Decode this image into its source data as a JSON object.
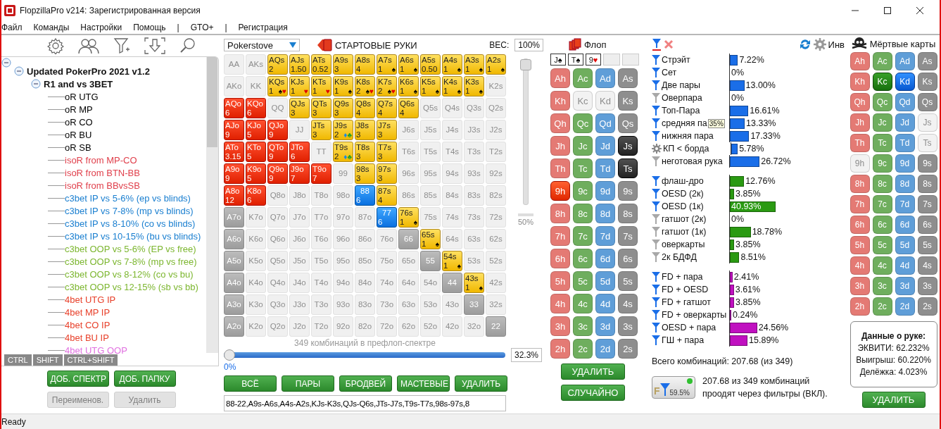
{
  "window": {
    "title": "FlopzillaPro v214: Зарегистрированная версия"
  },
  "menu": [
    "Файл",
    "Команды",
    "Настройки",
    "Помощь",
    "|",
    "GTO+",
    "|",
    "Регистрация"
  ],
  "tree": {
    "expanded": true,
    "children": [
      {
        "label": "Updated PokerPro 2021 v1.2",
        "expanded": true,
        "children": [
          {
            "label": "R1 and vs 3BET",
            "expanded": true,
            "children": [
              {
                "label": "oR UTG",
                "color": "#000000"
              },
              {
                "label": "oR MP",
                "color": "#000000"
              },
              {
                "label": "oR CO",
                "color": "#000000"
              },
              {
                "label": "oR BU",
                "color": "#000000"
              },
              {
                "label": "oR SB",
                "color": "#000000"
              },
              {
                "label": "isoR from MP-CO",
                "color": "#e0404c"
              },
              {
                "label": "isoR from BTN-BB",
                "color": "#e0404c"
              },
              {
                "label": "isoR from BBvsSB",
                "color": "#e0404c"
              },
              {
                "label": "c3bet IP vs 5-6% (ep vs blinds)",
                "color": "#1a7fd0"
              },
              {
                "label": "c3bet IP vs 7-8% (mp vs blinds)",
                "color": "#1a7fd0"
              },
              {
                "label": "c3bet IP vs 8-10% (co vs blinds)",
                "color": "#1a7fd0"
              },
              {
                "label": "c3bet IP vs 10-15% (bu vs blinds)",
                "color": "#1a7fd0"
              },
              {
                "label": "c3bet OOP vs 5-6% (EP vs free)",
                "color": "#7cb62f"
              },
              {
                "label": "c3bet OOP vs 7-8% (mp vs free)",
                "color": "#7cb62f"
              },
              {
                "label": "c3bet OOP vs 8-12% (co vs bu)",
                "color": "#7cb62f"
              },
              {
                "label": "c3bet OOP vs 12-15% (sb vs bb)",
                "color": "#7cb62f"
              },
              {
                "label": "4bet UTG IP",
                "color": "#e8402a"
              },
              {
                "label": "4bet MP IP",
                "color": "#e8402a"
              },
              {
                "label": "4bet CO IP",
                "color": "#e8402a"
              },
              {
                "label": "4bet BU IP",
                "color": "#e8402a"
              },
              {
                "label": "4bet UTG OOP",
                "color": "#e070e0"
              }
            ]
          }
        ]
      }
    ]
  },
  "modifier_tabs": [
    {
      "label": "CTRL",
      "selected": false
    },
    {
      "label": "SHIFT",
      "selected": false
    },
    {
      "label": "CTRL+SHIFT",
      "selected": false
    }
  ],
  "left_buttons": [
    {
      "label": "ДОБ. СПЕКТР",
      "disabled": false
    },
    {
      "label": "ДОБ. ПАПКУ",
      "disabled": false
    },
    {
      "label": "Переименов.",
      "disabled": true
    },
    {
      "label": "Удалить",
      "disabled": true
    }
  ],
  "range": {
    "source": "Pokerstove",
    "title": "СТАРТОВЫЕ РУКИ",
    "weight_label": "ВЕС:",
    "weight": "100%",
    "matrix": [
      [
        {
          "hand": "AA",
          "kind": "off"
        },
        {
          "hand": "AKs",
          "kind": "off"
        },
        {
          "hand": "AQs",
          "kind": "suited",
          "weight": "2"
        },
        {
          "hand": "AJs",
          "kind": "suited",
          "weight": "1.50"
        },
        {
          "hand": "ATs",
          "kind": "suited",
          "weight": "0.52"
        },
        {
          "hand": "A9s",
          "kind": "suited",
          "weight": "3"
        },
        {
          "hand": "A8s",
          "kind": "suited",
          "weight": "4"
        },
        {
          "hand": "A7s",
          "kind": "suited",
          "weight": "1",
          "suits": [
            {
              "glyph": "♠",
              "color": "#000000"
            }
          ]
        },
        {
          "hand": "A6s",
          "kind": "suited",
          "weight": "1",
          "suits": [
            {
              "glyph": "♠",
              "color": "#000000"
            }
          ]
        },
        {
          "hand": "A5s",
          "kind": "suited",
          "weight": "0.50"
        },
        {
          "hand": "A4s",
          "kind": "suited",
          "weight": "1",
          "suits": [
            {
              "glyph": "♠",
              "color": "#000000"
            }
          ]
        },
        {
          "hand": "A3s",
          "kind": "suited",
          "weight": "1",
          "suits": [
            {
              "glyph": "♠",
              "color": "#000000"
            }
          ]
        },
        {
          "hand": "A2s",
          "kind": "suited",
          "weight": "1",
          "suits": [
            {
              "glyph": "♠",
              "color": "#000000"
            }
          ]
        }
      ],
      [
        {
          "hand": "AKo",
          "kind": "off"
        },
        {
          "hand": "KK",
          "kind": "off"
        },
        {
          "hand": "KQs",
          "kind": "suited",
          "weight": "1",
          "suits": [
            {
              "glyph": "♠",
              "color": "#000000"
            },
            {
              "glyph": "♥",
              "color": "#e00000"
            }
          ]
        },
        {
          "hand": "KJs",
          "kind": "suited",
          "weight": "1",
          "suits": [
            {
              "glyph": "♥",
              "color": "#e00000"
            }
          ]
        },
        {
          "hand": "KTs",
          "kind": "suited",
          "weight": "1",
          "suits": [
            {
              "glyph": "♥",
              "color": "#e00000"
            }
          ]
        },
        {
          "hand": "K9s",
          "kind": "suited",
          "weight": "1",
          "suits": [
            {
              "glyph": "♠",
              "color": "#000000"
            }
          ]
        },
        {
          "hand": "K8s",
          "kind": "suited",
          "weight": "2",
          "suits": [
            {
              "glyph": "♠",
              "color": "#000000"
            },
            {
              "glyph": "♥",
              "color": "#e00000"
            }
          ]
        },
        {
          "hand": "K7s",
          "kind": "suited",
          "weight": "2",
          "suits": [
            {
              "glyph": "♠",
              "color": "#000000"
            },
            {
              "glyph": "♥",
              "color": "#e00000"
            }
          ]
        },
        {
          "hand": "K6s",
          "kind": "suited",
          "weight": "1",
          "suits": [
            {
              "glyph": "♠",
              "color": "#000000"
            }
          ]
        },
        {
          "hand": "K5s",
          "kind": "suited",
          "weight": "1",
          "suits": [
            {
              "glyph": "♠",
              "color": "#000000"
            }
          ]
        },
        {
          "hand": "K4s",
          "kind": "suited",
          "weight": "1",
          "suits": [
            {
              "glyph": "♠",
              "color": "#000000"
            }
          ]
        },
        {
          "hand": "K3s",
          "kind": "suited",
          "weight": "1",
          "suits": [
            {
              "glyph": "♠",
              "color": "#000000"
            }
          ]
        },
        {
          "hand": "K2s",
          "kind": "off"
        }
      ],
      [
        {
          "hand": "AQo",
          "kind": "offsuit",
          "weight": "6"
        },
        {
          "hand": "KQo",
          "kind": "offsuit",
          "weight": "6"
        },
        {
          "hand": "QQ",
          "kind": "off"
        },
        {
          "hand": "QJs",
          "kind": "suited",
          "weight": "3"
        },
        {
          "hand": "QTs",
          "kind": "suited",
          "weight": "3"
        },
        {
          "hand": "Q9s",
          "kind": "suited",
          "weight": "3"
        },
        {
          "hand": "Q8s",
          "kind": "suited",
          "weight": "4"
        },
        {
          "hand": "Q7s",
          "kind": "suited",
          "weight": "4"
        },
        {
          "hand": "Q6s",
          "kind": "suited",
          "weight": "4"
        },
        {
          "hand": "Q5s",
          "kind": "off"
        },
        {
          "hand": "Q4s",
          "kind": "off"
        },
        {
          "hand": "Q3s",
          "kind": "off"
        },
        {
          "hand": "Q2s",
          "kind": "off"
        }
      ],
      [
        {
          "hand": "AJo",
          "kind": "offsuit",
          "weight": "9"
        },
        {
          "hand": "KJo",
          "kind": "offsuit",
          "weight": "5"
        },
        {
          "hand": "QJo",
          "kind": "offsuit",
          "weight": "9"
        },
        {
          "hand": "JJ",
          "kind": "off"
        },
        {
          "hand": "JTs",
          "kind": "suited",
          "weight": "3"
        },
        {
          "hand": "J9s",
          "kind": "suited",
          "weight": "2",
          "suits": [
            {
              "glyph": "♦",
              "color": "#1a8ae8"
            },
            {
              "glyph": "♣",
              "color": "#20a020"
            }
          ]
        },
        {
          "hand": "J8s",
          "kind": "suited",
          "weight": "3"
        },
        {
          "hand": "J7s",
          "kind": "suited",
          "weight": "3"
        },
        {
          "hand": "J6s",
          "kind": "off"
        },
        {
          "hand": "J5s",
          "kind": "off"
        },
        {
          "hand": "J4s",
          "kind": "off"
        },
        {
          "hand": "J3s",
          "kind": "off"
        },
        {
          "hand": "J2s",
          "kind": "off"
        }
      ],
      [
        {
          "hand": "ATo",
          "kind": "offsuit",
          "weight": "3.15"
        },
        {
          "hand": "KTo",
          "kind": "offsuit",
          "weight": "5"
        },
        {
          "hand": "QTo",
          "kind": "offsuit",
          "weight": "9"
        },
        {
          "hand": "JTo",
          "kind": "offsuit",
          "weight": "6"
        },
        {
          "hand": "TT",
          "kind": "off"
        },
        {
          "hand": "T9s",
          "kind": "suited",
          "weight": "2",
          "suits": [
            {
              "glyph": "♦",
              "color": "#1a8ae8"
            },
            {
              "glyph": "♣",
              "color": "#20a020"
            }
          ]
        },
        {
          "hand": "T8s",
          "kind": "suited",
          "weight": "3"
        },
        {
          "hand": "T7s",
          "kind": "suited",
          "weight": "3"
        },
        {
          "hand": "T6s",
          "kind": "off"
        },
        {
          "hand": "T5s",
          "kind": "off"
        },
        {
          "hand": "T4s",
          "kind": "off"
        },
        {
          "hand": "T3s",
          "kind": "off"
        },
        {
          "hand": "T2s",
          "kind": "off"
        }
      ],
      [
        {
          "hand": "A9o",
          "kind": "offsuit",
          "weight": "9"
        },
        {
          "hand": "K9o",
          "kind": "offsuit",
          "weight": "5"
        },
        {
          "hand": "Q9o",
          "kind": "offsuit",
          "weight": "9"
        },
        {
          "hand": "J9o",
          "kind": "offsuit",
          "weight": "7"
        },
        {
          "hand": "T9o",
          "kind": "offsuit",
          "weight": "7"
        },
        {
          "hand": "99",
          "kind": "off"
        },
        {
          "hand": "98s",
          "kind": "suited",
          "weight": "3"
        },
        {
          "hand": "97s",
          "kind": "suited",
          "weight": "3"
        },
        {
          "hand": "96s",
          "kind": "off"
        },
        {
          "hand": "95s",
          "kind": "off"
        },
        {
          "hand": "94s",
          "kind": "off"
        },
        {
          "hand": "93s",
          "kind": "off"
        },
        {
          "hand": "92s",
          "kind": "off"
        }
      ],
      [
        {
          "hand": "A8o",
          "kind": "offsuit",
          "weight": "12"
        },
        {
          "hand": "K8o",
          "kind": "offsuit",
          "weight": "6"
        },
        {
          "hand": "Q8o",
          "kind": "off"
        },
        {
          "hand": "J8o",
          "kind": "off"
        },
        {
          "hand": "T8o",
          "kind": "off"
        },
        {
          "hand": "98o",
          "kind": "off"
        },
        {
          "hand": "88",
          "kind": "pair",
          "weight": "6"
        },
        {
          "hand": "87s",
          "kind": "suited",
          "weight": "4"
        },
        {
          "hand": "86s",
          "kind": "off"
        },
        {
          "hand": "85s",
          "kind": "off"
        },
        {
          "hand": "84s",
          "kind": "off"
        },
        {
          "hand": "83s",
          "kind": "off"
        },
        {
          "hand": "82s",
          "kind": "off"
        }
      ],
      [
        {
          "hand": "A7o",
          "kind": "dim"
        },
        {
          "hand": "K7o",
          "kind": "off"
        },
        {
          "hand": "Q7o",
          "kind": "off"
        },
        {
          "hand": "J7o",
          "kind": "off"
        },
        {
          "hand": "T7o",
          "kind": "off"
        },
        {
          "hand": "97o",
          "kind": "off"
        },
        {
          "hand": "87o",
          "kind": "off"
        },
        {
          "hand": "77",
          "kind": "pair",
          "weight": "6"
        },
        {
          "hand": "76s",
          "kind": "suited",
          "weight": "1",
          "suits": [
            {
              "glyph": "♠",
              "color": "#000000"
            }
          ]
        },
        {
          "hand": "75s",
          "kind": "off"
        },
        {
          "hand": "74s",
          "kind": "off"
        },
        {
          "hand": "73s",
          "kind": "off"
        },
        {
          "hand": "72s",
          "kind": "off"
        }
      ],
      [
        {
          "hand": "A6o",
          "kind": "dim"
        },
        {
          "hand": "K6o",
          "kind": "off"
        },
        {
          "hand": "Q6o",
          "kind": "off"
        },
        {
          "hand": "J6o",
          "kind": "off"
        },
        {
          "hand": "T6o",
          "kind": "off"
        },
        {
          "hand": "96o",
          "kind": "off"
        },
        {
          "hand": "86o",
          "kind": "off"
        },
        {
          "hand": "76o",
          "kind": "off"
        },
        {
          "hand": "66",
          "kind": "dim"
        },
        {
          "hand": "65s",
          "kind": "suited",
          "weight": "1",
          "suits": [
            {
              "glyph": "♠",
              "color": "#000000"
            }
          ]
        },
        {
          "hand": "64s",
          "kind": "off"
        },
        {
          "hand": "63s",
          "kind": "off"
        },
        {
          "hand": "62s",
          "kind": "off"
        }
      ],
      [
        {
          "hand": "A5o",
          "kind": "dim"
        },
        {
          "hand": "K5o",
          "kind": "off"
        },
        {
          "hand": "Q5o",
          "kind": "off"
        },
        {
          "hand": "J5o",
          "kind": "off"
        },
        {
          "hand": "T5o",
          "kind": "off"
        },
        {
          "hand": "95o",
          "kind": "off"
        },
        {
          "hand": "85o",
          "kind": "off"
        },
        {
          "hand": "75o",
          "kind": "off"
        },
        {
          "hand": "65o",
          "kind": "off"
        },
        {
          "hand": "55",
          "kind": "dim"
        },
        {
          "hand": "54s",
          "kind": "suited",
          "weight": "1",
          "suits": [
            {
              "glyph": "♠",
              "color": "#000000"
            }
          ]
        },
        {
          "hand": "53s",
          "kind": "off"
        },
        {
          "hand": "52s",
          "kind": "off"
        }
      ],
      [
        {
          "hand": "A4o",
          "kind": "dim"
        },
        {
          "hand": "K4o",
          "kind": "off"
        },
        {
          "hand": "Q4o",
          "kind": "off"
        },
        {
          "hand": "J4o",
          "kind": "off"
        },
        {
          "hand": "T4o",
          "kind": "off"
        },
        {
          "hand": "94o",
          "kind": "off"
        },
        {
          "hand": "84o",
          "kind": "off"
        },
        {
          "hand": "74o",
          "kind": "off"
        },
        {
          "hand": "64o",
          "kind": "off"
        },
        {
          "hand": "54o",
          "kind": "off"
        },
        {
          "hand": "44",
          "kind": "dim"
        },
        {
          "hand": "43s",
          "kind": "suited",
          "weight": "1",
          "suits": [
            {
              "glyph": "♠",
              "color": "#000000"
            }
          ]
        },
        {
          "hand": "42s",
          "kind": "off"
        }
      ],
      [
        {
          "hand": "A3o",
          "kind": "dim"
        },
        {
          "hand": "K3o",
          "kind": "off"
        },
        {
          "hand": "Q3o",
          "kind": "off"
        },
        {
          "hand": "J3o",
          "kind": "off"
        },
        {
          "hand": "T3o",
          "kind": "off"
        },
        {
          "hand": "93o",
          "kind": "off"
        },
        {
          "hand": "83o",
          "kind": "off"
        },
        {
          "hand": "73o",
          "kind": "off"
        },
        {
          "hand": "63o",
          "kind": "off"
        },
        {
          "hand": "53o",
          "kind": "off"
        },
        {
          "hand": "43o",
          "kind": "off"
        },
        {
          "hand": "33",
          "kind": "dim"
        },
        {
          "hand": "32s",
          "kind": "off"
        }
      ],
      [
        {
          "hand": "A2o",
          "kind": "dim"
        },
        {
          "hand": "K2o",
          "kind": "off"
        },
        {
          "hand": "Q2o",
          "kind": "off"
        },
        {
          "hand": "J2o",
          "kind": "off"
        },
        {
          "hand": "T2o",
          "kind": "off"
        },
        {
          "hand": "92o",
          "kind": "off"
        },
        {
          "hand": "82o",
          "kind": "off"
        },
        {
          "hand": "72o",
          "kind": "off"
        },
        {
          "hand": "62o",
          "kind": "off"
        },
        {
          "hand": "52o",
          "kind": "off"
        },
        {
          "hand": "42o",
          "kind": "off"
        },
        {
          "hand": "32o",
          "kind": "off"
        },
        {
          "hand": "22",
          "kind": "dim"
        }
      ]
    ],
    "weight_slider": {
      "level": 1,
      "label": "50%"
    },
    "combo_caption": "349 комбинаций в префлоп-спектре",
    "percent_slider": {
      "level": 0,
      "min_label": "0%",
      "value": "32.3%"
    },
    "buttons": [
      "ВСЁ",
      "ПАРЫ",
      "БРОДВЕЙ",
      "МАСТЕВЫЕ",
      "УДАЛИТЬ"
    ],
    "range_text": "88-22,A9s-A6s,A4s-A2s,KJs-K3s,QJs-Q6s,JTs-J7s,T9s-T7s,98s-97s,8"
  },
  "flop": {
    "title": "Флоп",
    "board": [
      {
        "kind": "card",
        "rank": "J",
        "suit": "♠",
        "color": "#000000"
      },
      {
        "kind": "card",
        "rank": "T",
        "suit": "♠",
        "color": "#000000"
      },
      {
        "kind": "card",
        "rank": "9",
        "suit": "♥",
        "color": "#e00000"
      },
      {
        "kind": "empty"
      },
      {
        "kind": "empty"
      }
    ],
    "cards": [
      {
        "label": "Ah",
        "kind": "hearts",
        "selected": false,
        "disabled": false
      },
      {
        "label": "Ac",
        "kind": "clubs",
        "selected": false,
        "disabled": false
      },
      {
        "label": "Ad",
        "kind": "diamonds",
        "selected": false,
        "disabled": false
      },
      {
        "label": "As",
        "kind": "spades",
        "selected": false,
        "disabled": false
      },
      {
        "label": "Kh",
        "kind": "hearts",
        "selected": false,
        "disabled": false
      },
      {
        "label": "Kc",
        "kind": "clubs",
        "selected": false,
        "disabled": true
      },
      {
        "label": "Kd",
        "kind": "diamonds",
        "selected": false,
        "disabled": true
      },
      {
        "label": "Ks",
        "kind": "spades",
        "selected": false,
        "disabled": false
      },
      {
        "label": "Qh",
        "kind": "hearts",
        "selected": false,
        "disabled": false
      },
      {
        "label": "Qc",
        "kind": "clubs",
        "selected": false,
        "disabled": false
      },
      {
        "label": "Qd",
        "kind": "diamonds",
        "selected": false,
        "disabled": false
      },
      {
        "label": "Qs",
        "kind": "spades",
        "selected": false,
        "disabled": false
      },
      {
        "label": "Jh",
        "kind": "hearts",
        "selected": false,
        "disabled": false
      },
      {
        "label": "Jc",
        "kind": "clubs",
        "selected": false,
        "disabled": false
      },
      {
        "label": "Jd",
        "kind": "diamonds",
        "selected": false,
        "disabled": false
      },
      {
        "label": "Js",
        "kind": "spades",
        "selected": true,
        "disabled": false
      },
      {
        "label": "Th",
        "kind": "hearts",
        "selected": false,
        "disabled": false
      },
      {
        "label": "Tc",
        "kind": "clubs",
        "selected": false,
        "disabled": false
      },
      {
        "label": "Td",
        "kind": "diamonds",
        "selected": false,
        "disabled": false
      },
      {
        "label": "Ts",
        "kind": "spades",
        "selected": true,
        "disabled": false
      },
      {
        "label": "9h",
        "kind": "hearts",
        "selected": true,
        "disabled": false
      },
      {
        "label": "9c",
        "kind": "clubs",
        "selected": false,
        "disabled": false
      },
      {
        "label": "9d",
        "kind": "diamonds",
        "selected": false,
        "disabled": false
      },
      {
        "label": "9s",
        "kind": "spades",
        "selected": false,
        "disabled": false
      },
      {
        "label": "8h",
        "kind": "hearts",
        "selected": false,
        "disabled": false
      },
      {
        "label": "8c",
        "kind": "clubs",
        "selected": false,
        "disabled": false
      },
      {
        "label": "8d",
        "kind": "diamonds",
        "selected": false,
        "disabled": false
      },
      {
        "label": "8s",
        "kind": "spades",
        "selected": false,
        "disabled": false
      },
      {
        "label": "7h",
        "kind": "hearts",
        "selected": false,
        "disabled": false
      },
      {
        "label": "7c",
        "kind": "clubs",
        "selected": false,
        "disabled": false
      },
      {
        "label": "7d",
        "kind": "diamonds",
        "selected": false,
        "disabled": false
      },
      {
        "label": "7s",
        "kind": "spades",
        "selected": false,
        "disabled": false
      },
      {
        "label": "6h",
        "kind": "hearts",
        "selected": false,
        "disabled": false
      },
      {
        "label": "6c",
        "kind": "clubs",
        "selected": false,
        "disabled": false
      },
      {
        "label": "6d",
        "kind": "diamonds",
        "selected": false,
        "disabled": false
      },
      {
        "label": "6s",
        "kind": "spades",
        "selected": false,
        "disabled": false
      },
      {
        "label": "5h",
        "kind": "hearts",
        "selected": false,
        "disabled": false
      },
      {
        "label": "5c",
        "kind": "clubs",
        "selected": false,
        "disabled": false
      },
      {
        "label": "5d",
        "kind": "diamonds",
        "selected": false,
        "disabled": false
      },
      {
        "label": "5s",
        "kind": "spades",
        "selected": false,
        "disabled": false
      },
      {
        "label": "4h",
        "kind": "hearts",
        "selected": false,
        "disabled": false
      },
      {
        "label": "4c",
        "kind": "clubs",
        "selected": false,
        "disabled": false
      },
      {
        "label": "4d",
        "kind": "diamonds",
        "selected": false,
        "disabled": false
      },
      {
        "label": "4s",
        "kind": "spades",
        "selected": false,
        "disabled": false
      },
      {
        "label": "3h",
        "kind": "hearts",
        "selected": false,
        "disabled": false
      },
      {
        "label": "3c",
        "kind": "clubs",
        "selected": false,
        "disabled": false
      },
      {
        "label": "3d",
        "kind": "diamonds",
        "selected": false,
        "disabled": false
      },
      {
        "label": "3s",
        "kind": "spades",
        "selected": false,
        "disabled": false
      },
      {
        "label": "2h",
        "kind": "hearts",
        "selected": false,
        "disabled": false
      },
      {
        "label": "2c",
        "kind": "clubs",
        "selected": false,
        "disabled": false
      },
      {
        "label": "2d",
        "kind": "diamonds",
        "selected": false,
        "disabled": false
      },
      {
        "label": "2s",
        "kind": "spades",
        "selected": false,
        "disabled": false
      }
    ],
    "buttons": [
      "УДАЛИТЬ",
      "СЛУЧАЙНО"
    ]
  },
  "stats": {
    "toggle_label": "Инв",
    "groups": [
      {
        "color": "#1a6ee8",
        "rows": [
          {
            "kind": "filter",
            "active": true,
            "label": "Стрэйт",
            "value": "7.22%",
            "level": 0.0722
          },
          {
            "kind": "filter",
            "active": true,
            "label": "Сет",
            "value": "0%",
            "level": 0
          },
          {
            "kind": "filter",
            "active": true,
            "label": "Две пары",
            "value": "13.00%",
            "level": 0.13
          },
          {
            "kind": "filter",
            "active": false,
            "label": "Оверпара",
            "value": "0%",
            "level": 0
          },
          {
            "kind": "filter",
            "active": true,
            "label": "Топ-Пара",
            "value": "16.61%",
            "level": 0.1661
          },
          {
            "kind": "filter",
            "active": true,
            "label": "средняя па",
            "value": "13.33%",
            "level": 0.1333,
            "tooltip": "35%"
          },
          {
            "kind": "filter",
            "active": true,
            "label": "нижняя пара",
            "value": "17.33%",
            "level": 0.1733
          },
          {
            "kind": "gear",
            "label": "КП < борда",
            "value": "5.78%",
            "level": 0.0578
          },
          {
            "kind": "filter",
            "active": false,
            "label": "неготовая рука",
            "value": "26.72%",
            "level": 0.2672
          }
        ]
      },
      {
        "color": "#2a9a12",
        "rows": [
          {
            "kind": "filter",
            "active": true,
            "label": "флаш-дро",
            "value": "12.76%",
            "level": 0.1276
          },
          {
            "kind": "filter",
            "active": true,
            "label": "OESD (2к)",
            "value": "3.85%",
            "level": 0.0385
          },
          {
            "kind": "filter",
            "active": true,
            "label": "OESD (1к)",
            "value": "40.93%",
            "level": 0.4093
          },
          {
            "kind": "filter",
            "active": false,
            "label": "гатшот (2к)",
            "value": "0%",
            "level": 0
          },
          {
            "kind": "filter",
            "active": false,
            "label": "гатшот (1к)",
            "value": "18.78%",
            "level": 0.1878
          },
          {
            "kind": "filter",
            "active": false,
            "label": "оверкарты",
            "value": "3.85%",
            "level": 0.0385
          },
          {
            "kind": "filter",
            "active": false,
            "label": "2к БДФД",
            "value": "8.51%",
            "level": 0.0851
          }
        ]
      },
      {
        "color": "#c010c0",
        "rows": [
          {
            "kind": "filter",
            "active": true,
            "label": "FD + пара",
            "value": "2.41%",
            "level": 0.0241
          },
          {
            "kind": "filter",
            "active": true,
            "label": "FD + OESD",
            "value": "3.61%",
            "level": 0.0361
          },
          {
            "kind": "filter",
            "active": true,
            "label": "FD + гатшот",
            "value": "3.85%",
            "level": 0.0385
          },
          {
            "kind": "filter",
            "active": true,
            "label": "FD + оверкарты",
            "value": "0.24%",
            "level": 0.0024
          },
          {
            "kind": "filter",
            "active": true,
            "label": "OESD + пара",
            "value": "24.56%",
            "level": 0.2456
          },
          {
            "kind": "filter",
            "active": true,
            "label": "ГШ + пара",
            "value": "15.89%",
            "level": 0.1589
          }
        ]
      }
    ],
    "total": "Всего комбинаций: 207.68 (из 349)",
    "filter_button": {
      "letter": "F",
      "value": "59.5%",
      "on": true
    },
    "filter_note": "207.68 из 349 комбинаций проодят через фильтры (ВКЛ)."
  },
  "dead": {
    "title": "Мёртвые карты",
    "cards": [
      {
        "label": "Ah",
        "kind": "hearts",
        "selected": false,
        "disabled": false
      },
      {
        "label": "Ac",
        "kind": "clubs",
        "selected": false,
        "disabled": false
      },
      {
        "label": "Ad",
        "kind": "diamonds",
        "selected": false,
        "disabled": false
      },
      {
        "label": "As",
        "kind": "spades",
        "selected": false,
        "disabled": false
      },
      {
        "label": "Kh",
        "kind": "hearts",
        "selected": false,
        "disabled": false
      },
      {
        "label": "Kc",
        "kind": "clubs",
        "selected": true,
        "disabled": false
      },
      {
        "label": "Kd",
        "kind": "diamonds",
        "selected": true,
        "disabled": false
      },
      {
        "label": "Ks",
        "kind": "spades",
        "selected": false,
        "disabled": false
      },
      {
        "label": "Qh",
        "kind": "hearts",
        "selected": false,
        "disabled": false
      },
      {
        "label": "Qc",
        "kind": "clubs",
        "selected": false,
        "disabled": false
      },
      {
        "label": "Qd",
        "kind": "diamonds",
        "selected": false,
        "disabled": false
      },
      {
        "label": "Qs",
        "kind": "spades",
        "selected": false,
        "disabled": false
      },
      {
        "label": "Jh",
        "kind": "hearts",
        "selected": false,
        "disabled": false
      },
      {
        "label": "Jc",
        "kind": "clubs",
        "selected": false,
        "disabled": false
      },
      {
        "label": "Jd",
        "kind": "diamonds",
        "selected": false,
        "disabled": false
      },
      {
        "label": "Js",
        "kind": "spades",
        "selected": false,
        "disabled": true
      },
      {
        "label": "Th",
        "kind": "hearts",
        "selected": false,
        "disabled": false
      },
      {
        "label": "Tc",
        "kind": "clubs",
        "selected": false,
        "disabled": false
      },
      {
        "label": "Td",
        "kind": "diamonds",
        "selected": false,
        "disabled": false
      },
      {
        "label": "Ts",
        "kind": "spades",
        "selected": false,
        "disabled": true
      },
      {
        "label": "9h",
        "kind": "hearts",
        "selected": false,
        "disabled": true
      },
      {
        "label": "9c",
        "kind": "clubs",
        "selected": false,
        "disabled": false
      },
      {
        "label": "9d",
        "kind": "diamonds",
        "selected": false,
        "disabled": false
      },
      {
        "label": "9s",
        "kind": "spades",
        "selected": false,
        "disabled": false
      },
      {
        "label": "8h",
        "kind": "hearts",
        "selected": false,
        "disabled": false
      },
      {
        "label": "8c",
        "kind": "clubs",
        "selected": false,
        "disabled": false
      },
      {
        "label": "8d",
        "kind": "diamonds",
        "selected": false,
        "disabled": false
      },
      {
        "label": "8s",
        "kind": "spades",
        "selected": false,
        "disabled": false
      },
      {
        "label": "7h",
        "kind": "hearts",
        "selected": false,
        "disabled": false
      },
      {
        "label": "7c",
        "kind": "clubs",
        "selected": false,
        "disabled": false
      },
      {
        "label": "7d",
        "kind": "diamonds",
        "selected": false,
        "disabled": false
      },
      {
        "label": "7s",
        "kind": "spades",
        "selected": false,
        "disabled": false
      },
      {
        "label": "6h",
        "kind": "hearts",
        "selected": false,
        "disabled": false
      },
      {
        "label": "6c",
        "kind": "clubs",
        "selected": false,
        "disabled": false
      },
      {
        "label": "6d",
        "kind": "diamonds",
        "selected": false,
        "disabled": false
      },
      {
        "label": "6s",
        "kind": "spades",
        "selected": false,
        "disabled": false
      },
      {
        "label": "5h",
        "kind": "hearts",
        "selected": false,
        "disabled": false
      },
      {
        "label": "5c",
        "kind": "clubs",
        "selected": false,
        "disabled": false
      },
      {
        "label": "5d",
        "kind": "diamonds",
        "selected": false,
        "disabled": false
      },
      {
        "label": "5s",
        "kind": "spades",
        "selected": false,
        "disabled": false
      },
      {
        "label": "4h",
        "kind": "hearts",
        "selected": false,
        "disabled": false
      },
      {
        "label": "4c",
        "kind": "clubs",
        "selected": false,
        "disabled": false
      },
      {
        "label": "4d",
        "kind": "diamonds",
        "selected": false,
        "disabled": false
      },
      {
        "label": "4s",
        "kind": "spades",
        "selected": false,
        "disabled": false
      },
      {
        "label": "3h",
        "kind": "hearts",
        "selected": false,
        "disabled": false
      },
      {
        "label": "3c",
        "kind": "clubs",
        "selected": false,
        "disabled": false
      },
      {
        "label": "3d",
        "kind": "diamonds",
        "selected": false,
        "disabled": false
      },
      {
        "label": "3s",
        "kind": "spades",
        "selected": false,
        "disabled": false
      },
      {
        "label": "2h",
        "kind": "hearts",
        "selected": false,
        "disabled": false
      },
      {
        "label": "2c",
        "kind": "clubs",
        "selected": false,
        "disabled": false
      },
      {
        "label": "2d",
        "kind": "diamonds",
        "selected": false,
        "disabled": false
      },
      {
        "label": "2s",
        "kind": "spades",
        "selected": false,
        "disabled": false
      }
    ],
    "hand_data": {
      "title": "Данные о руке:",
      "lines": [
        "ЭКВИТИ: 62.232%",
        "Выигрыш: 60.220%",
        "Делёжка: 4.023%"
      ]
    },
    "button": "УДАЛИТЬ"
  },
  "status_bar": "Ready"
}
